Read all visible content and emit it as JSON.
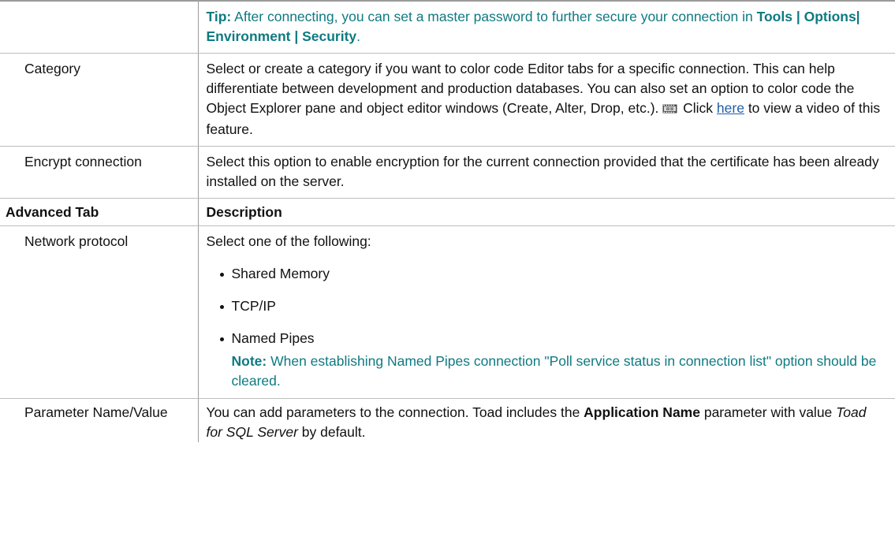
{
  "colors": {
    "tip": "#0e7a82",
    "link": "#1f5fa8",
    "border": "#9a9a9a"
  },
  "tip": {
    "label": "Tip:",
    "text_before": " After connecting, you can set a master password to further secure your connection in ",
    "menu_path": "Tools | Options| Environment | Security",
    "text_after": "."
  },
  "rows": {
    "category": {
      "label": "Category",
      "text_before": "Select or create a category if you want to color code Editor tabs for a specific connection. This can help differentiate between development and production databases. You can also set an option to color code the Object Explorer pane and object editor windows (Create, Alter, Drop, etc.).",
      "video_icon": "film-icon",
      "click_text": " Click ",
      "link_text": "here",
      "text_after": " to view a video of this feature."
    },
    "encrypt": {
      "label": "Encrypt connection",
      "text": "Select this option to enable encryption for the current connection provided that the certificate has been already installed on the server."
    },
    "advanced_header": {
      "label": "Advanced Tab",
      "description": "Description"
    },
    "network": {
      "label": "Network protocol",
      "intro": "Select one of the following:",
      "options": [
        "Shared Memory",
        "TCP/IP",
        "Named Pipes"
      ],
      "note_label": "Note:",
      "note_text": " When establishing Named Pipes connection \"Poll service status in connection list\" option should be cleared."
    },
    "parameter": {
      "label": "Parameter Name/Value",
      "text_before": "You can add parameters to the connection. Toad includes the ",
      "bold_text": "Application Name",
      "text_middle": " parameter with value ",
      "italic_text": "Toad for SQL Server",
      "text_after": " by default."
    }
  }
}
